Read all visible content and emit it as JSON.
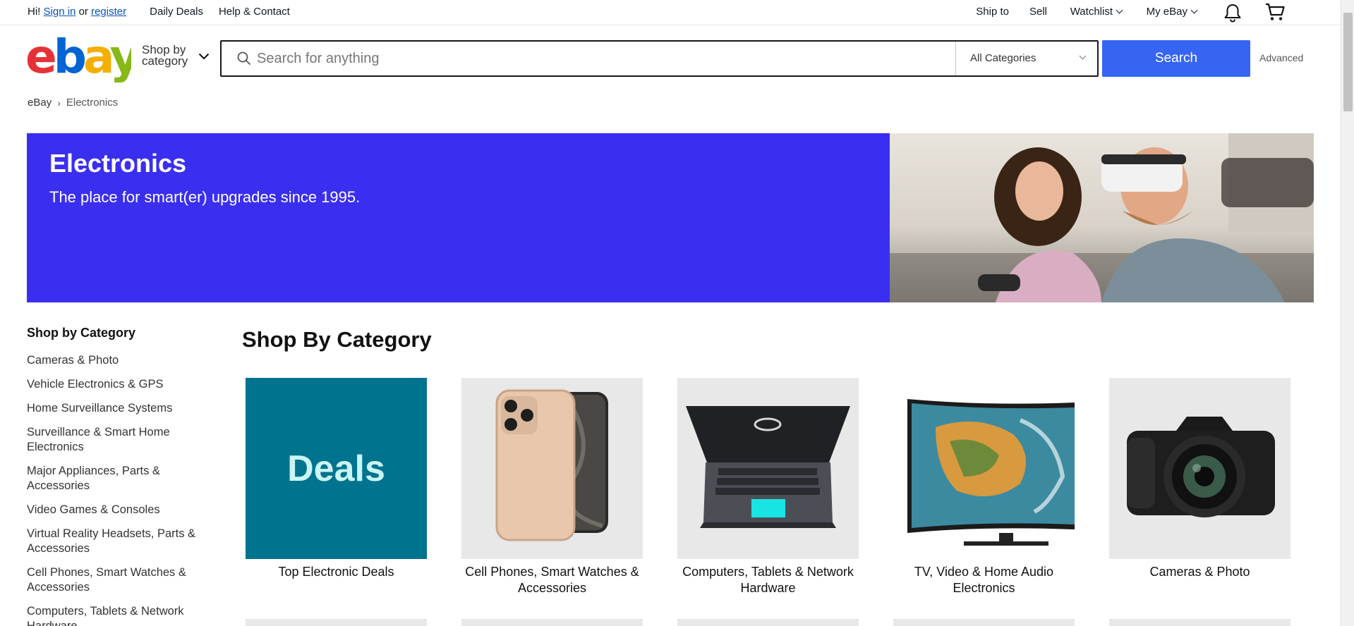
{
  "topbar": {
    "greeting": "Hi!",
    "sign_in": "Sign in",
    "or": "or",
    "register": "register",
    "daily_deals": "Daily Deals",
    "help": "Help & Contact",
    "ship_to": "Ship to",
    "sell": "Sell",
    "watchlist": "Watchlist",
    "my_ebay": "My eBay"
  },
  "header": {
    "logo_text": "ebay",
    "shop_by_line1": "Shop by",
    "shop_by_line2": "category",
    "search_placeholder": "Search for anything",
    "category_selected": "All Categories",
    "search_button": "Search",
    "advanced": "Advanced"
  },
  "breadcrumb": {
    "root": "eBay",
    "separator": "›",
    "current": "Electronics"
  },
  "hero": {
    "title": "Electronics",
    "subtitle": "The place for smart(er) upgrades since 1995.",
    "background": "#3a2ff0"
  },
  "sidebar": {
    "title": "Shop by Category",
    "items": [
      "Cameras & Photo",
      "Vehicle Electronics & GPS",
      "Home Surveillance Systems",
      "Surveillance & Smart Home Electronics",
      "Major Appliances, Parts & Accessories",
      "Video Games & Consoles",
      "Virtual Reality Headsets, Parts & Accessories",
      "Cell Phones, Smart Watches & Accessories",
      "Computers, Tablets & Network Hardware"
    ]
  },
  "main": {
    "title": "Shop By Category",
    "cards": [
      {
        "label": "Top Electronic Deals",
        "thumb_text": "Deals"
      },
      {
        "label": "Cell Phones, Smart Watches & Accessories"
      },
      {
        "label": "Computers, Tablets & Network Hardware"
      },
      {
        "label": "TV, Video & Home Audio Electronics"
      },
      {
        "label": "Cameras & Photo"
      }
    ]
  },
  "colors": {
    "accent": "#3665f3",
    "link": "#0654ba",
    "deals_bg": "#00738f"
  }
}
